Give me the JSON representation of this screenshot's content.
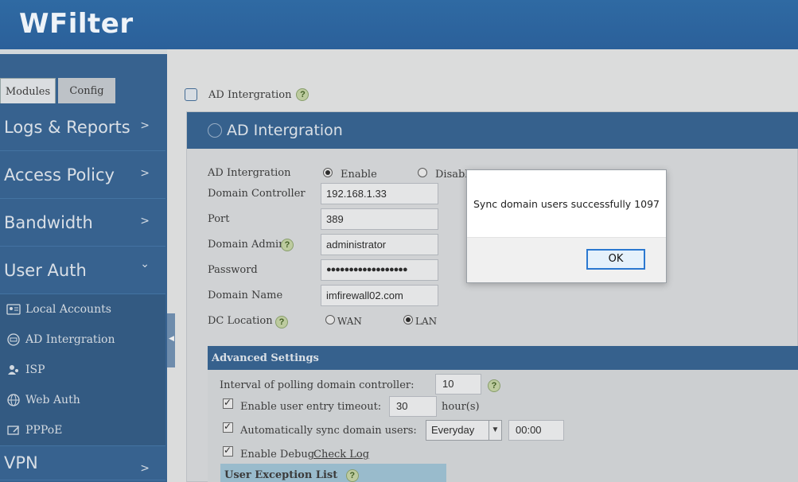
{
  "app": {
    "brand": "WFilter"
  },
  "sidebar": {
    "tabs": {
      "modules": "Modules",
      "config": "Config"
    },
    "items": [
      {
        "label": "Logs & Reports",
        "chevron": ">"
      },
      {
        "label": "Access Policy",
        "chevron": ">"
      },
      {
        "label": "Bandwidth",
        "chevron": ">"
      },
      {
        "label": "User Auth",
        "chevron": "⌄"
      }
    ],
    "sub_items": [
      {
        "label": "Local Accounts",
        "icon": "id-card-icon"
      },
      {
        "label": "AD Intergration",
        "icon": "ad-icon"
      },
      {
        "label": "ISP",
        "icon": "user-group-icon"
      },
      {
        "label": "Web Auth",
        "icon": "globe-icon"
      },
      {
        "label": "PPPoE",
        "icon": "pppoe-icon"
      }
    ],
    "vpn": {
      "label": "VPN",
      "chevron": ">"
    }
  },
  "breadcrumb": {
    "label": "AD Intergration",
    "help": "?"
  },
  "panel": {
    "title": "AD Intergration",
    "fields": {
      "ad_label": "AD Intergration",
      "enable": "Enable",
      "disable": "Disabl",
      "dc_label": "Domain Controller",
      "dc_value": "192.168.1.33",
      "port_label": "Port",
      "port_value": "389",
      "admin_label": "Domain Admin",
      "admin_value": "administrator",
      "password_label": "Password",
      "password_value": "●●●●●●●●●●●●●●●●●●",
      "domain_label": "Domain Name",
      "domain_value": "imfirewall02.com",
      "location_label": "DC Location",
      "wan": "WAN",
      "lan": "LAN",
      "help": "?"
    },
    "advanced": {
      "title": "Advanced Settings",
      "polling_label": "Interval of polling domain controller:",
      "polling_value": "10",
      "timeout_label": "Enable user entry timeout:",
      "timeout_value": "30",
      "timeout_unit": "hour(s)",
      "sync_label": "Automatically sync domain users:",
      "sync_option": "Everyday",
      "sync_time": "00:00",
      "debug_label": "Enable Debug",
      "check_log": "Check Log",
      "exception_title": "User Exception List",
      "help": "?"
    }
  },
  "dialog": {
    "message": "Sync domain users successfully 1097",
    "ok": "OK"
  }
}
